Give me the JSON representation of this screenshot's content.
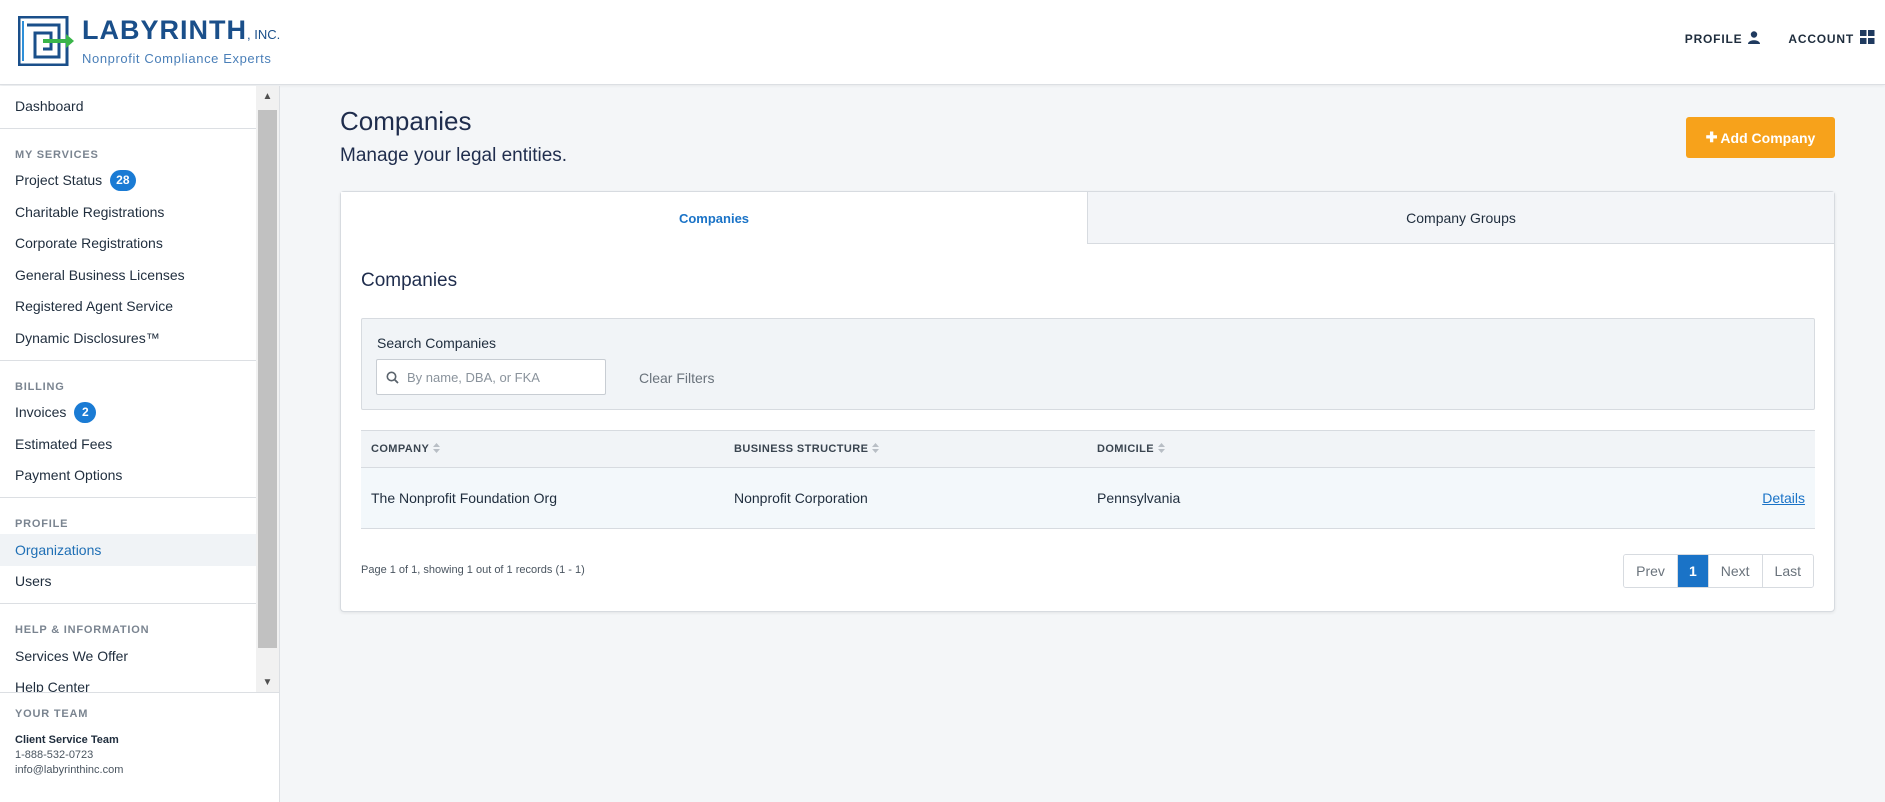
{
  "header": {
    "logo_name": "LABYRINTH",
    "logo_suffix": ", INC.",
    "logo_tagline": "Nonprofit Compliance Experts",
    "profile_label": "PROFILE",
    "account_label": "ACCOUNT"
  },
  "sidebar": {
    "dashboard": "Dashboard",
    "my_services": {
      "title": "MY SERVICES",
      "items": [
        {
          "label": "Project Status",
          "badge": "28"
        },
        {
          "label": "Charitable Registrations"
        },
        {
          "label": "Corporate Registrations"
        },
        {
          "label": "General Business Licenses"
        },
        {
          "label": "Registered Agent Service"
        },
        {
          "label": "Dynamic Disclosures™"
        }
      ]
    },
    "billing": {
      "title": "BILLING",
      "items": [
        {
          "label": "Invoices",
          "badge": "2"
        },
        {
          "label": "Estimated Fees"
        },
        {
          "label": "Payment Options"
        }
      ]
    },
    "profile": {
      "title": "PROFILE",
      "items": [
        {
          "label": "Organizations"
        },
        {
          "label": "Users"
        }
      ]
    },
    "help": {
      "title": "HELP & INFORMATION",
      "items": [
        {
          "label": "Services We Offer"
        },
        {
          "label": "Help Center"
        }
      ]
    },
    "team": {
      "title": "YOUR TEAM",
      "name": "Client Service Team",
      "phone": "1-888-532-0723",
      "email": "info@labyrinthinc.com"
    }
  },
  "main": {
    "title": "Companies",
    "subtitle": "Manage your legal entities.",
    "add_button": "Add Company",
    "tabs": [
      {
        "label": "Companies",
        "active": true
      },
      {
        "label": "Company Groups",
        "active": false
      }
    ],
    "section_title": "Companies",
    "filters": {
      "label": "Search Companies",
      "placeholder": "By name, DBA, or FKA",
      "value": "",
      "clear_label": "Clear Filters"
    },
    "table": {
      "headers": [
        "COMPANY",
        "BUSINESS STRUCTURE",
        "DOMICILE"
      ],
      "rows": [
        {
          "company": "The Nonprofit Foundation Org",
          "structure": "Nonprofit Corporation",
          "domicile": "Pennsylvania",
          "action": "Details"
        }
      ]
    },
    "pagination": {
      "info": "Page 1 of 1, showing 1 out of 1 records (1 - 1)",
      "prev": "Prev",
      "current": "1",
      "next": "Next",
      "last": "Last"
    }
  },
  "colors": {
    "accent": "#1a73c7",
    "button_orange": "#f7a21b",
    "badge_blue": "#1a7bd4"
  }
}
